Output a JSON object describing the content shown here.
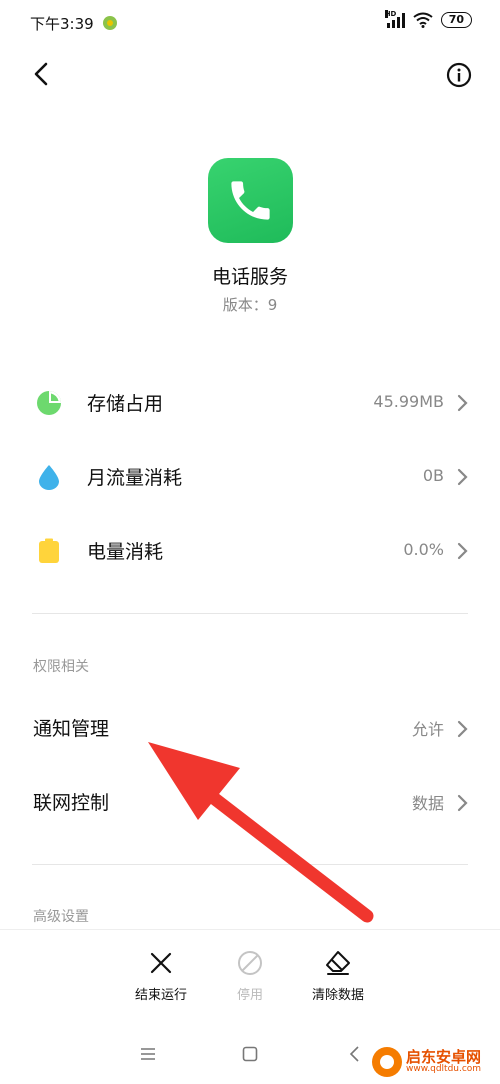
{
  "status_bar": {
    "time": "下午3:39",
    "hd": "HD",
    "battery": "70"
  },
  "app": {
    "name": "电话服务",
    "version": "版本：9"
  },
  "usage": [
    {
      "label": "存储占用",
      "value": "45.99MB",
      "icon": "pie-chart-icon",
      "color": "#6dd96e"
    },
    {
      "label": "月流量消耗",
      "value": "0B",
      "icon": "water-drop-icon",
      "color": "#3fb2ea"
    },
    {
      "label": "电量消耗",
      "value": "0.0%",
      "icon": "battery-icon",
      "color": "#ffd43b"
    }
  ],
  "permissions": {
    "title": "权限相关",
    "items": [
      {
        "label": "通知管理",
        "value": "允许"
      },
      {
        "label": "联网控制",
        "value": "数据"
      }
    ]
  },
  "advanced": {
    "title": "高级设置"
  },
  "actions": [
    {
      "label": "结束运行",
      "icon": "close-icon",
      "enabled": true
    },
    {
      "label": "停用",
      "icon": "disable-icon",
      "enabled": false
    },
    {
      "label": "清除数据",
      "icon": "eraser-icon",
      "enabled": true
    }
  ],
  "watermark": {
    "title": "启东安卓网",
    "url": "www.qdltdu.com"
  },
  "colors": {
    "accent_green": "#2ec866",
    "annotation_arrow": "#f0362e"
  }
}
